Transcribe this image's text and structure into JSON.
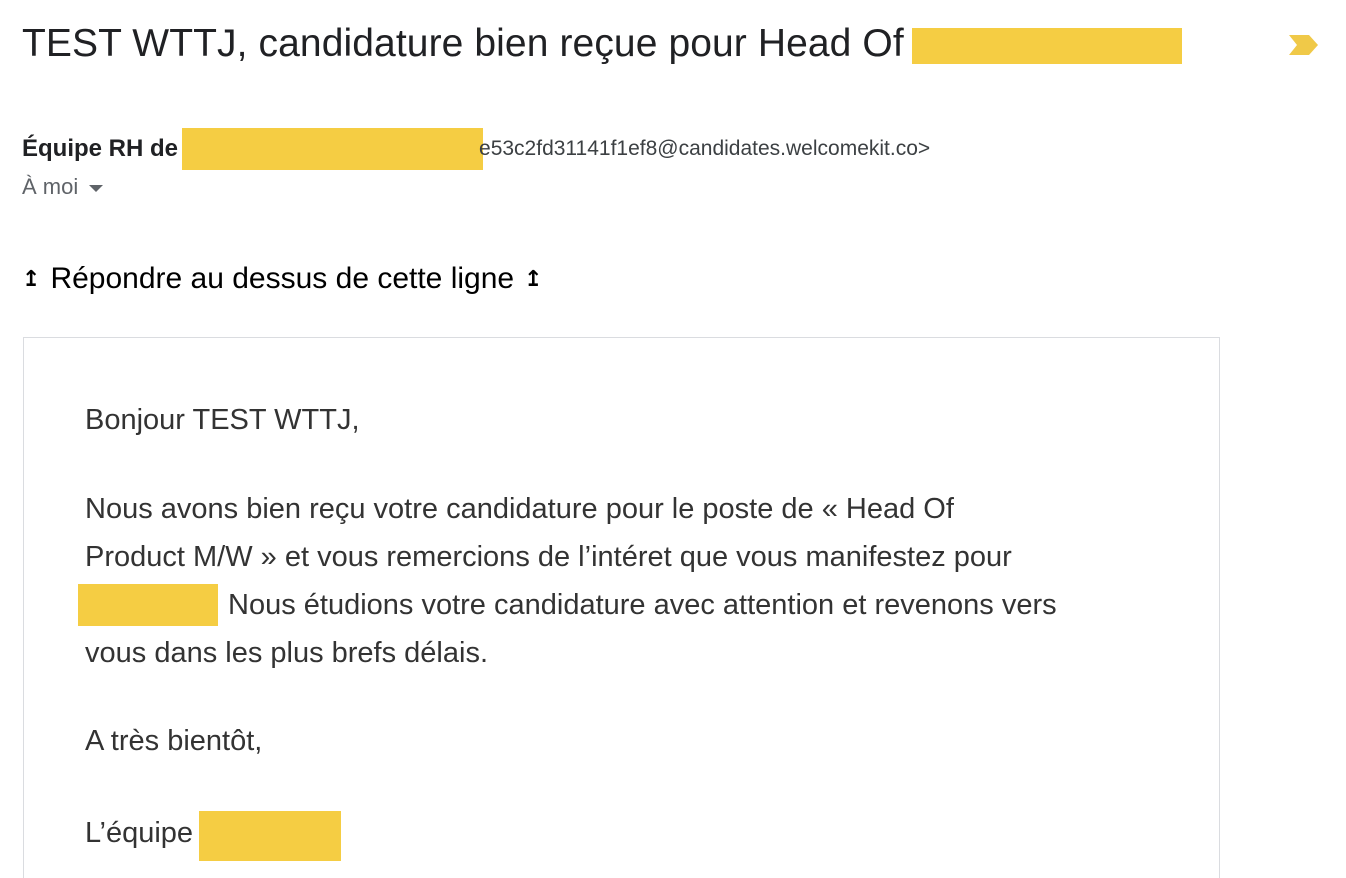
{
  "email": {
    "subject": "TEST WTTJ, candidature bien reçue pour Head Of",
    "importance_marker": "importance-marker-icon",
    "sender": {
      "name": "Équipe RH de",
      "email_fragment": "e53c2fd31141f1ef8@candidates.welcomekit.co>"
    },
    "recipient": {
      "label": "À moi"
    },
    "reply_line": {
      "text": "Répondre au dessus de cette ligne",
      "glyph": "↥"
    },
    "body": {
      "greeting": "Bonjour TEST WTTJ,",
      "paragraph_line1": "Nous avons bien reçu votre candidature pour le poste de « Head Of",
      "paragraph_line2": "Product M/W » et vous remercions de l’intéret que vous manifestez pour",
      "paragraph_line3": "Nous étudions votre candidature avec attention et revenons vers",
      "paragraph_line4": "vous dans les plus brefs délais.",
      "closing": "A très bientôt,",
      "signature": "L’équipe"
    }
  },
  "colors": {
    "redaction": "#f5cd43",
    "importance_marker": "#f0c948",
    "border": "#dadce0"
  }
}
